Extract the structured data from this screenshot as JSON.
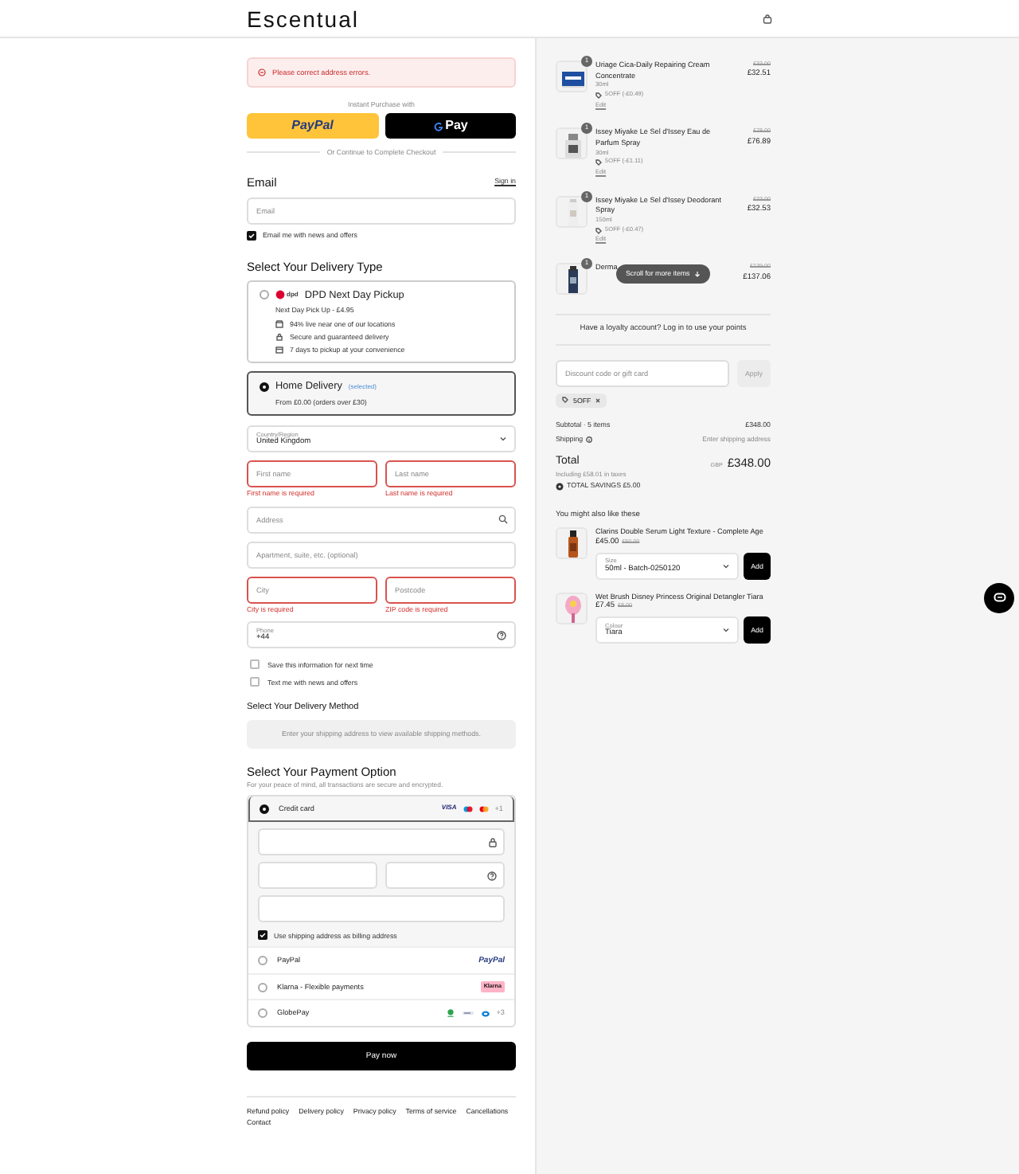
{
  "header": {
    "logo": "Escentual"
  },
  "checkout": {
    "error": "Please correct address errors.",
    "express_label": "Instant Purchase with",
    "express_buttons": [
      {
        "kind": "paypal",
        "label": "PayPal"
      },
      {
        "kind": "gpay",
        "label": "Pay"
      }
    ],
    "divider_text": "Or Continue to Complete Checkout",
    "email": {
      "heading": "Email",
      "sign_in": "Sign in",
      "placeholder": "Email",
      "news_label": "Email me with news and offers",
      "news_checked": true
    },
    "delivery_type": {
      "heading": "Select Your Delivery Type",
      "options": [
        {
          "title": "DPD Next Day Pickup",
          "badge": "dpd",
          "selected": false,
          "lines": [
            "Next Day Pick Up - £4.95"
          ],
          "features": [
            "94% live near one of our locations",
            "Secure and guaranteed delivery",
            "7 days to pickup at your convenience"
          ]
        },
        {
          "title": "Home Delivery",
          "tag": "(selected)",
          "selected": true,
          "lines": [
            "From £0.00 (orders over £30)"
          ]
        }
      ]
    },
    "country": {
      "label": "Country/Region",
      "value": "United Kingdom"
    },
    "address_rows": [
      [
        {
          "placeholder": "First name",
          "error": "First name is required"
        },
        {
          "placeholder": "Last name",
          "error": "Last name is required"
        }
      ],
      [
        {
          "placeholder": "Address",
          "kind": "search"
        }
      ],
      [
        {
          "placeholder": "Apartment, suite, etc. (optional)"
        }
      ],
      [
        {
          "placeholder": "City",
          "error": "City is required"
        },
        {
          "placeholder": "Postcode",
          "error": "ZIP code is required"
        }
      ],
      [
        {
          "label": "Phone",
          "value": "+44",
          "kind": "help"
        }
      ]
    ],
    "options": [
      {
        "label": "Save this information for next time",
        "checked": false
      },
      {
        "label": "Text me with news and offers",
        "checked": false
      }
    ],
    "delivery_method": {
      "heading": "Select Your Delivery Method",
      "message": "Enter your shipping address to view available shipping methods."
    },
    "payment": {
      "heading": "Select Your Payment Option",
      "subtitle": "For your peace of mind, all transactions are secure and encrypted.",
      "methods": [
        {
          "kind": "card",
          "label": "Credit card",
          "selected": true,
          "brand": "VISA",
          "more": "+1"
        },
        {
          "kind": "paypal",
          "label": "PayPal",
          "selected": false,
          "brand": "PayPal"
        },
        {
          "kind": "klarna",
          "label": "Klarna - Flexible payments",
          "selected": false,
          "brand": "Klarna"
        },
        {
          "kind": "globepay",
          "label": "GlobePay",
          "selected": false,
          "more": "+3"
        }
      ],
      "billing_label": "Use shipping address as billing address",
      "billing_checked": true
    },
    "pay_button": "Pay now",
    "footer_links": [
      "Refund policy",
      "Delivery policy",
      "Privacy policy",
      "Terms of service",
      "Cancellations",
      "Contact"
    ]
  },
  "summary": {
    "items": [
      {
        "qty": "1",
        "name": "Uriage Cica-Daily Repairing Cream Concentrate",
        "size": "30ml",
        "discount": "5OFF (-£0.49)",
        "edit": "Edit",
        "old_price": "£33.00",
        "price": "£32.51"
      },
      {
        "qty": "1",
        "name": "Issey Miyake Le Sel d'Issey Eau de Parfum Spray",
        "size": "30ml",
        "discount": "5OFF (-£1.11)",
        "edit": "Edit",
        "old_price": "£78.00",
        "price": "£76.89"
      },
      {
        "qty": "1",
        "name": "Issey Miyake Le Sel d'Issey Deodorant Spray",
        "size": "150ml",
        "discount": "5OFF (-£0.47)",
        "edit": "Edit",
        "old_price": "£33.00",
        "price": "£32.53"
      },
      {
        "qty": "1",
        "name": "Derma",
        "old_price": "£139.00",
        "price": "£137.06"
      }
    ],
    "scroll_hint": "Scroll for more items",
    "loyalty": "Have a loyalty account? Log in to use your points",
    "discount_placeholder": "Discount code or gift card",
    "apply": "Apply",
    "code": "5OFF",
    "subtotal_label": "Subtotal · 5 items",
    "subtotal": "£348.00",
    "shipping_label": "Shipping",
    "shipping": "Enter shipping address",
    "total_label": "Total",
    "currency": "GBP",
    "total": "£348.00",
    "taxes": "Including £58.01 in taxes",
    "savings": "TOTAL SAVINGS £5.00",
    "recommend_heading": "You might also like these",
    "recommendations": [
      {
        "name": "Clarins Double Serum Light Texture - Complete Age",
        "price": "£45.00",
        "old_price": "£50.00",
        "option_label": "Size",
        "option_value": "50ml - Batch-0250120",
        "add": "Add"
      },
      {
        "name": "Wet Brush Disney Princess Original Detangler Tiara",
        "price": "£7.45",
        "old_price": "£8.00",
        "option_label": "Colour",
        "option_value": "Tiara",
        "add": "Add"
      }
    ]
  }
}
